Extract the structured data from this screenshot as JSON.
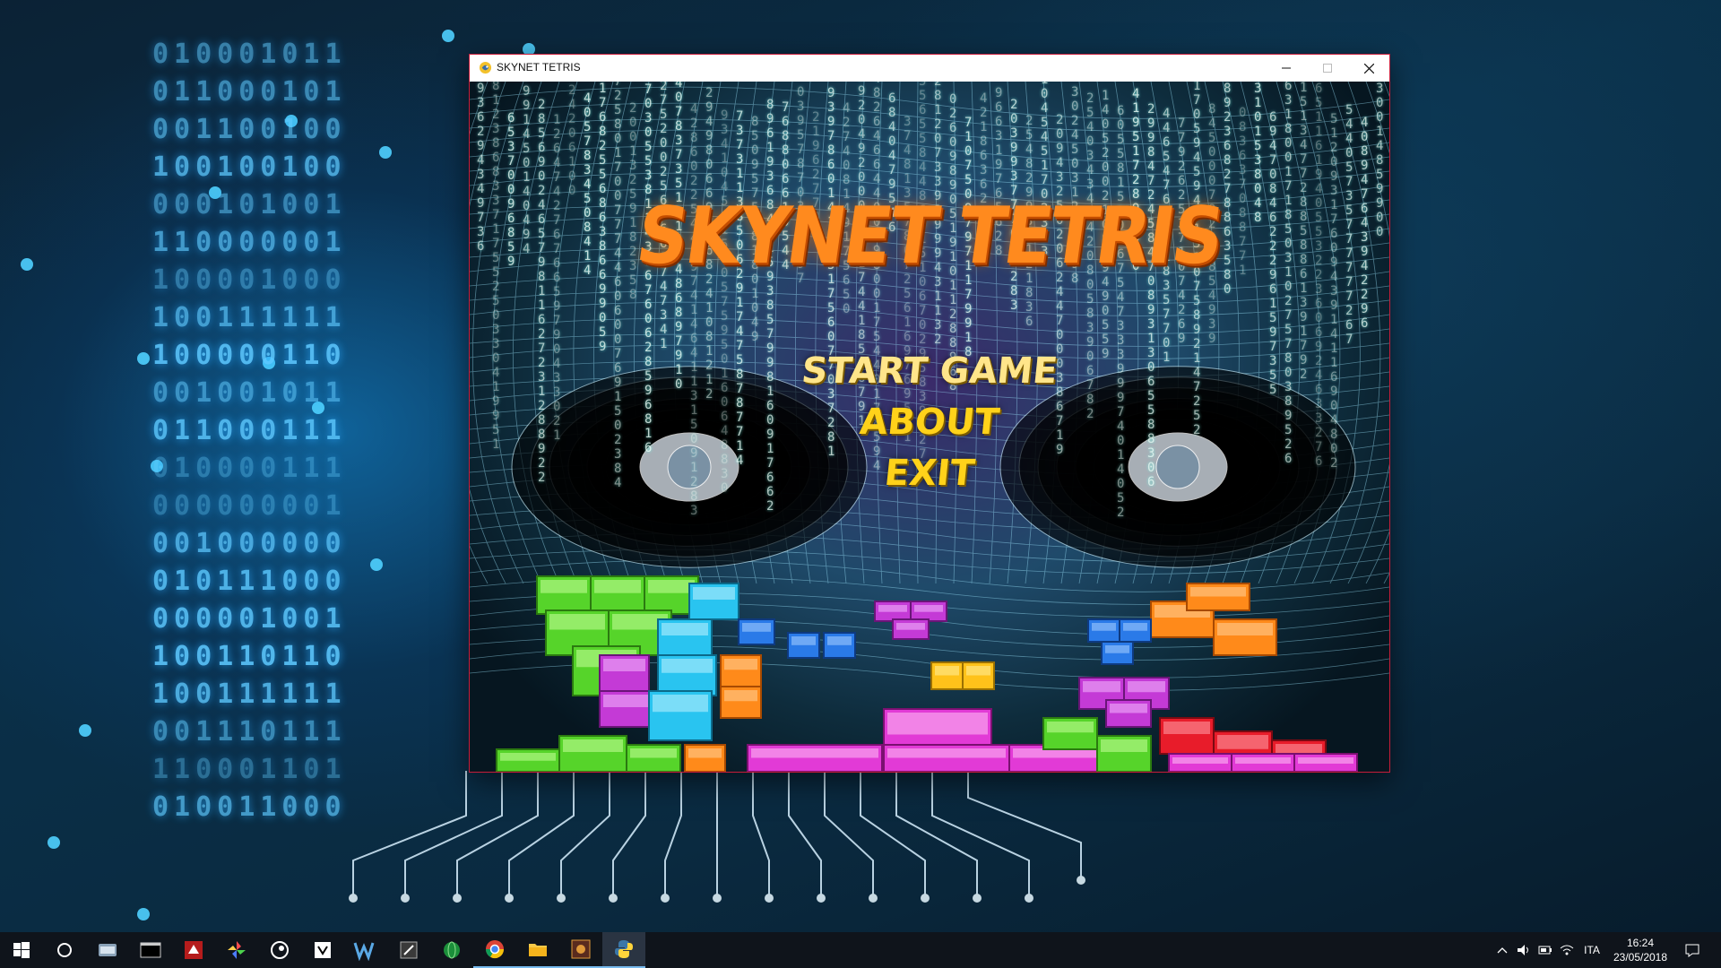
{
  "window": {
    "title": "SKYNET TETRIS",
    "minimize_icon": "minimize-icon",
    "maximize_icon": "maximize-icon",
    "close_icon": "close-icon"
  },
  "game": {
    "title": "SKYNET TETRIS",
    "menu": {
      "start": "START GAME",
      "about": "ABOUT",
      "exit": "EXIT"
    },
    "colors": {
      "title": "#ff8a1e",
      "menu_start": "#ffe58a",
      "menu_other": "#ffd21a"
    }
  },
  "taskbar": {
    "items": [
      {
        "icon": "windows-start-icon"
      },
      {
        "icon": "cortana-search-icon"
      },
      {
        "icon": "file-manager-icon"
      },
      {
        "icon": "terminal-icon"
      },
      {
        "icon": "dragon-app-icon"
      },
      {
        "icon": "pinwheel-app-icon"
      },
      {
        "icon": "steam-icon"
      },
      {
        "icon": "visual-studio-icon"
      },
      {
        "icon": "w-app-icon"
      },
      {
        "icon": "settings-app-icon"
      },
      {
        "icon": "green-globe-icon"
      },
      {
        "icon": "chrome-icon"
      },
      {
        "icon": "file-explorer-icon"
      },
      {
        "icon": "game-app-icon"
      },
      {
        "icon": "python-icon"
      }
    ],
    "tray": {
      "language": "ITA",
      "time": "16:24",
      "date": "23/05/2018"
    }
  }
}
